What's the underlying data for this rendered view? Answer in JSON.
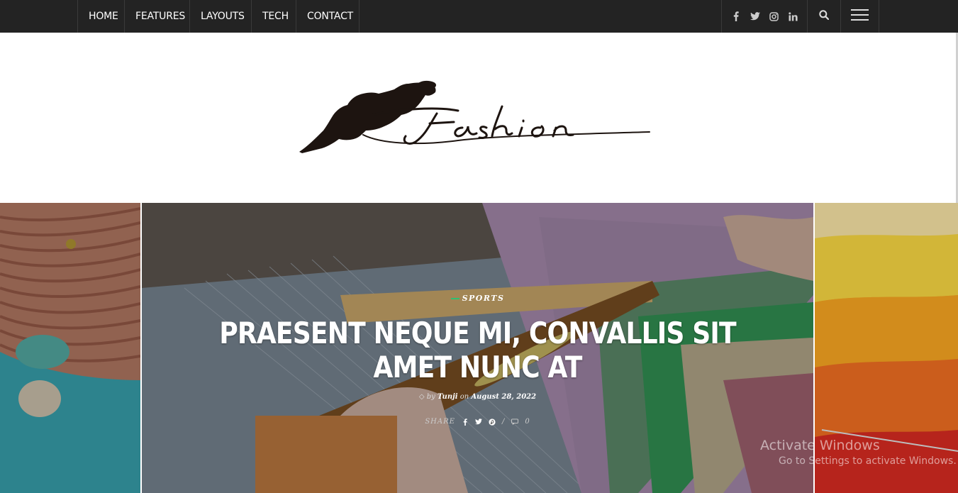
{
  "nav": {
    "items": [
      {
        "label": "HOME"
      },
      {
        "label": "FEATURES"
      },
      {
        "label": "LAYOUTS"
      },
      {
        "label": "TECH"
      },
      {
        "label": "CONTACT"
      }
    ],
    "social_icons": [
      "facebook-icon",
      "twitter-icon",
      "instagram-icon",
      "linkedin-icon"
    ],
    "search_icon": "search-icon",
    "menu_icon": "hamburger-menu-icon"
  },
  "logo": {
    "text": "Fashion",
    "color": "#1d1410"
  },
  "slider": {
    "main": {
      "category": "SPORTS",
      "title": "PRAESENT NEQUE MI, CONVALLIS SIT AMET NUNC AT",
      "by_label": "by",
      "author": "Tunji",
      "on_label": "on",
      "date": "August 28, 2022",
      "share_label": "SHARE",
      "comments": "0"
    },
    "accent_color": "#2fbf71"
  },
  "watermark": {
    "line1": "Activate Windows",
    "line2": "Go to Settings to activate Windows."
  }
}
